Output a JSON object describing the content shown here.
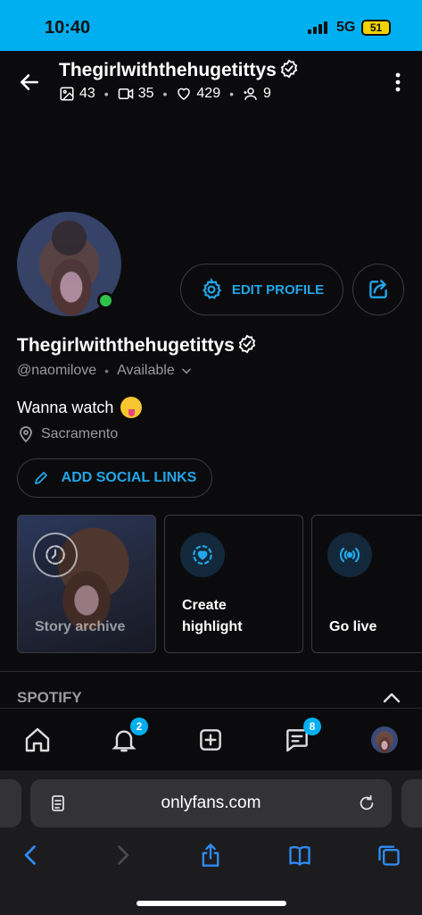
{
  "status_bar": {
    "time": "10:40",
    "network": "5G",
    "battery": "51"
  },
  "header": {
    "title": "Thegirlwiththehugetittys",
    "stats": {
      "photos": "43",
      "videos": "35",
      "likes": "429",
      "fans": "9"
    }
  },
  "profile": {
    "edit_label": "EDIT PROFILE",
    "name": "Thegirlwiththehugetittys",
    "handle": "@naomilove",
    "availability": "Available",
    "bio": "Wanna watch",
    "location": "Sacramento",
    "social_label": "ADD SOCIAL LINKS"
  },
  "cards": {
    "story": "Story archive",
    "highlight_line1": "Create",
    "highlight_line2": "highlight",
    "live": "Go live"
  },
  "sections": {
    "spotify": "SPOTIFY"
  },
  "bottom_nav": {
    "notifications_badge": "2",
    "messages_badge": "8"
  },
  "browser": {
    "url": "onlyfans.com"
  },
  "colors": {
    "accent": "#00aff0",
    "link": "#22a6e8",
    "online": "#2fc24a"
  },
  "icons": [
    "back-icon",
    "verified-icon",
    "image-icon",
    "video-icon",
    "heart-icon",
    "fans-icon",
    "kebab-icon",
    "gear-icon",
    "share-icon",
    "chevron-down-icon",
    "location-icon",
    "pencil-icon",
    "clock-icon",
    "heart-highlight-icon",
    "broadcast-icon",
    "chevron-up-icon",
    "home-icon",
    "bell-icon",
    "plus-square-icon",
    "message-icon",
    "page-icon",
    "reload-icon",
    "back-arrow-icon",
    "forward-arrow-icon",
    "share-tray-icon",
    "book-icon",
    "tabs-icon"
  ]
}
